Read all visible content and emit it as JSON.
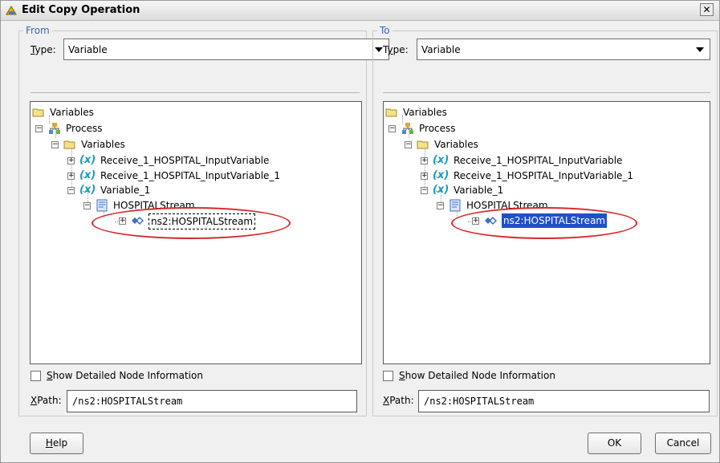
{
  "window": {
    "title": "Edit Copy Operation",
    "close_glyph": "✕"
  },
  "from": {
    "legend": "From",
    "type_label": "Type:",
    "type_value": "Variable",
    "tree": [
      {
        "label": "Variables",
        "icon": "folder-icon"
      },
      {
        "label": "Process",
        "icon": "process-icon"
      },
      {
        "label": "Variables",
        "icon": "folder-icon"
      },
      {
        "label": "Receive_1_HOSPITAL_InputVariable",
        "icon": "variable-icon"
      },
      {
        "label": "Receive_1_HOSPITAL_InputVariable_1",
        "icon": "variable-icon"
      },
      {
        "label": "Variable_1",
        "icon": "variable-icon"
      },
      {
        "label": "HOSPITALStream",
        "icon": "schema-icon"
      },
      {
        "label": "ns2:HOSPITALStream",
        "icon": "element-icon",
        "state": "focused"
      }
    ],
    "show_detail_label": "Show Detailed Node Information",
    "show_detail_checked": false,
    "xpath_label": "XPath:",
    "xpath_value": "/ns2:HOSPITALStream"
  },
  "to": {
    "legend": "To",
    "type_label": "Type:",
    "type_value": "Variable",
    "tree": [
      {
        "label": "Variables",
        "icon": "folder-icon"
      },
      {
        "label": "Process",
        "icon": "process-icon"
      },
      {
        "label": "Variables",
        "icon": "folder-icon"
      },
      {
        "label": "Receive_1_HOSPITAL_InputVariable",
        "icon": "variable-icon"
      },
      {
        "label": "Receive_1_HOSPITAL_InputVariable_1",
        "icon": "variable-icon"
      },
      {
        "label": "Variable_1",
        "icon": "variable-icon"
      },
      {
        "label": "HOSPITALStream",
        "icon": "schema-icon"
      },
      {
        "label": "ns2:HOSPITALStream",
        "icon": "element-icon",
        "state": "selected"
      }
    ],
    "show_detail_label": "Show Detailed Node Information",
    "show_detail_checked": false,
    "xpath_label": "XPath:",
    "xpath_value": "/ns2:HOSPITALStream"
  },
  "buttons": {
    "help": "Help",
    "ok": "OK",
    "cancel": "Cancel"
  },
  "colors": {
    "legend": "#3a64b5",
    "selection": "#2050c8",
    "annotation_ellipse": "#d8262a",
    "variable_icon": "#1b9bb8"
  }
}
